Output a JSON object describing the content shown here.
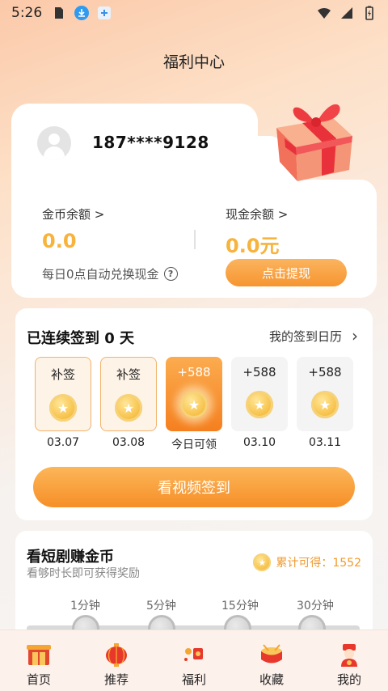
{
  "status_bar": {
    "time": "5:26"
  },
  "page": {
    "title": "福利中心"
  },
  "account": {
    "phone": "187****9128",
    "coin_balance_label": "金币余额 >",
    "coin_balance_value": "0.0",
    "cash_balance_label": "现金余额 >",
    "cash_balance_value": "0.0元",
    "exchange_note": "每日0点自动兑换现金",
    "help_icon": "?",
    "withdraw_label": "点击提现"
  },
  "sign_in": {
    "title": "已连续签到 0 天",
    "calendar_link": "我的签到日历",
    "days": [
      {
        "top": "补签",
        "date": "03.07",
        "state": "makeup"
      },
      {
        "top": "补签",
        "date": "03.08",
        "state": "makeup"
      },
      {
        "top": "+588",
        "date": "今日可领",
        "state": "today"
      },
      {
        "top": "+588",
        "date": "03.10",
        "state": "future"
      },
      {
        "top": "+588",
        "date": "03.11",
        "state": "future"
      }
    ],
    "watch_button": "看视频签到"
  },
  "drama": {
    "title": "看短剧赚金币",
    "subtitle": "看够时长即可获得奖励",
    "accumulated": "累计可得：1552",
    "milestones": [
      "1分钟",
      "5分钟",
      "15分钟",
      "30分钟"
    ]
  },
  "bottom_nav": [
    {
      "label": "首页",
      "icon": "home-icon"
    },
    {
      "label": "推荐",
      "icon": "lantern-icon"
    },
    {
      "label": "福利",
      "icon": "gift-icon"
    },
    {
      "label": "收藏",
      "icon": "drum-icon"
    },
    {
      "label": "我的",
      "icon": "fortune-god-icon"
    }
  ],
  "colors": {
    "accent": "#f69530",
    "gold": "#f7b33b"
  }
}
